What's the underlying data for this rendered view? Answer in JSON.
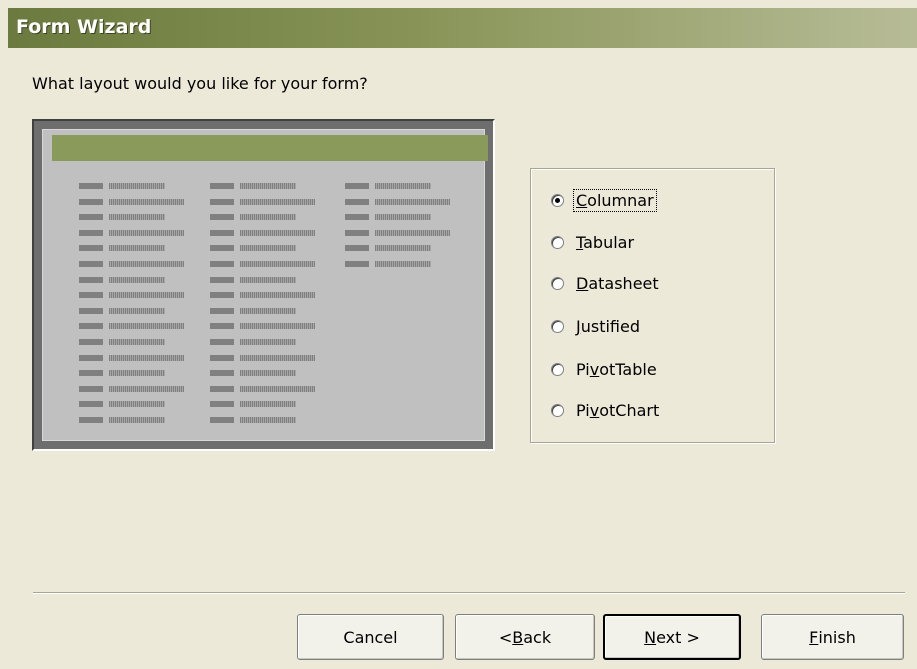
{
  "window": {
    "title": "Form Wizard"
  },
  "prompt": "What layout would you like for your form?",
  "layout_options": [
    {
      "label": "Columnar",
      "mnemonic": "C",
      "selected": true
    },
    {
      "label": "Tabular",
      "mnemonic": "T",
      "selected": false
    },
    {
      "label": "Datasheet",
      "mnemonic": "D",
      "selected": false
    },
    {
      "label": "Justified",
      "mnemonic": "J",
      "selected": false
    },
    {
      "label": "PivotTable",
      "mnemonic": "v",
      "selected": false
    },
    {
      "label": "PivotChart",
      "mnemonic": "v",
      "selected": false
    }
  ],
  "buttons": {
    "cancel": "Cancel",
    "back": "< Back",
    "next": "Next >",
    "finish": "Finish"
  },
  "colors": {
    "title_bar": "#889457",
    "preview_header": "#8a9a5b",
    "dialog_bg": "#ece9d8"
  }
}
